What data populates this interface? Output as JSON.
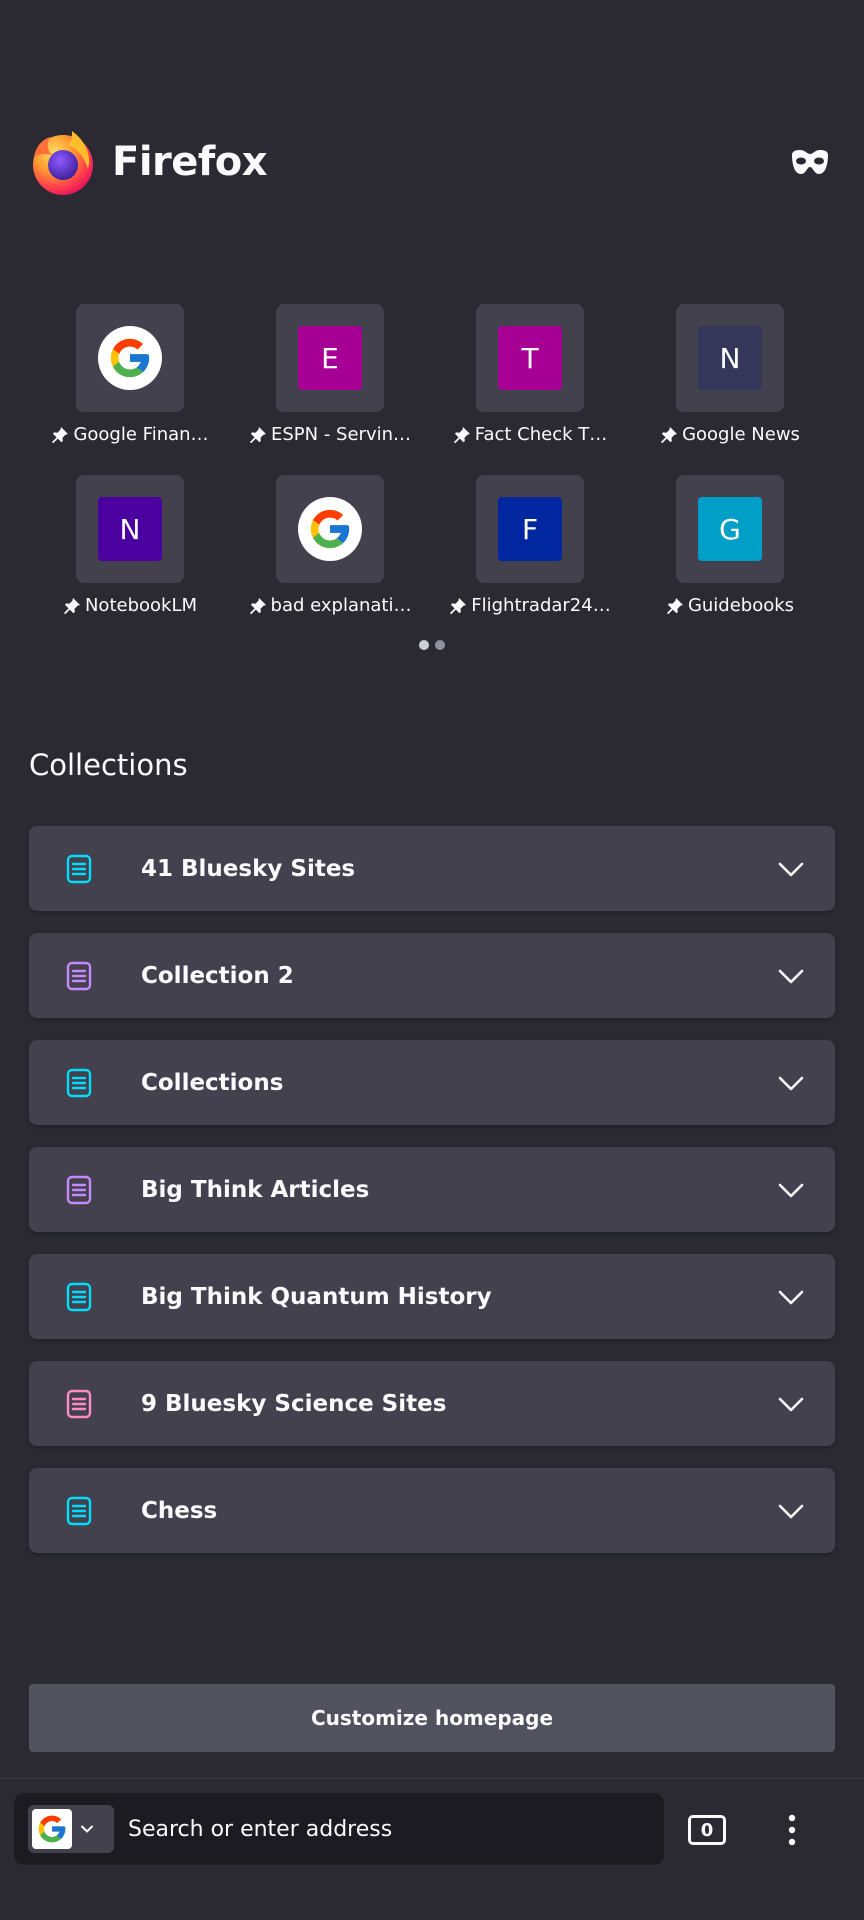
{
  "header": {
    "brand": "Firefox"
  },
  "shortcuts": [
    {
      "title": "Google Finan…",
      "icon": "google-g-logo",
      "type": "google"
    },
    {
      "title": "ESPN - Servin…",
      "letter": "E",
      "color": "#a60095"
    },
    {
      "title": "Fact Check T…",
      "letter": "T",
      "color": "#a60095"
    },
    {
      "title": "Google News",
      "letter": "N",
      "color": "#35375a"
    },
    {
      "title": "NotebookLM",
      "letter": "N",
      "color": "#4b00a0"
    },
    {
      "title": "bad explanati…",
      "icon": "google-g-logo",
      "type": "google"
    },
    {
      "title": "Flightradar24…",
      "letter": "F",
      "color": "#0026a0"
    },
    {
      "title": "Guidebooks",
      "letter": "G",
      "color": "#009fc8"
    }
  ],
  "collections_title": "Collections",
  "collections": [
    {
      "name": "41 Bluesky Sites",
      "color": "#00ddff"
    },
    {
      "name": "Collection 2",
      "color": "#c689ff"
    },
    {
      "name": "Collections",
      "color": "#00ddff"
    },
    {
      "name": "Big Think Articles",
      "color": "#c689ff"
    },
    {
      "name": "Big Think Quantum History",
      "color": "#00ddff"
    },
    {
      "name": "9 Bluesky Science Sites",
      "color": "#ff8ac5"
    },
    {
      "name": "Chess",
      "color": "#00ddff"
    }
  ],
  "customize_label": "Customize homepage",
  "toolbar": {
    "search_placeholder": "Search or enter address",
    "tab_count": "0"
  }
}
